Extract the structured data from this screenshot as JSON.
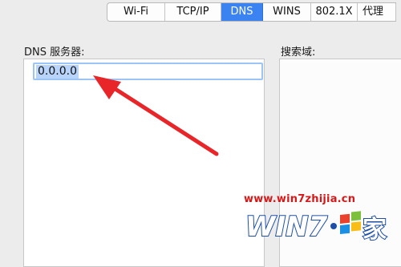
{
  "tabs": [
    {
      "label": "Wi-Fi",
      "active": false
    },
    {
      "label": "TCP/IP",
      "active": false
    },
    {
      "label": "DNS",
      "active": true
    },
    {
      "label": "WINS",
      "active": false
    },
    {
      "label": "802.1X",
      "active": false
    },
    {
      "label": "代理",
      "active": false
    }
  ],
  "dns": {
    "label": "DNS 服务器:",
    "servers": [
      "0.0.0.0"
    ]
  },
  "search": {
    "label": "搜索域:",
    "domains": []
  },
  "watermark": {
    "url": "www.win7zhijia.cn",
    "logo_text": "WIN7之家"
  },
  "colors": {
    "accent": "#3a83f0",
    "selection": "#b8d4fb",
    "annotation_arrow": "#e8262a",
    "watermark": "#d81818"
  }
}
